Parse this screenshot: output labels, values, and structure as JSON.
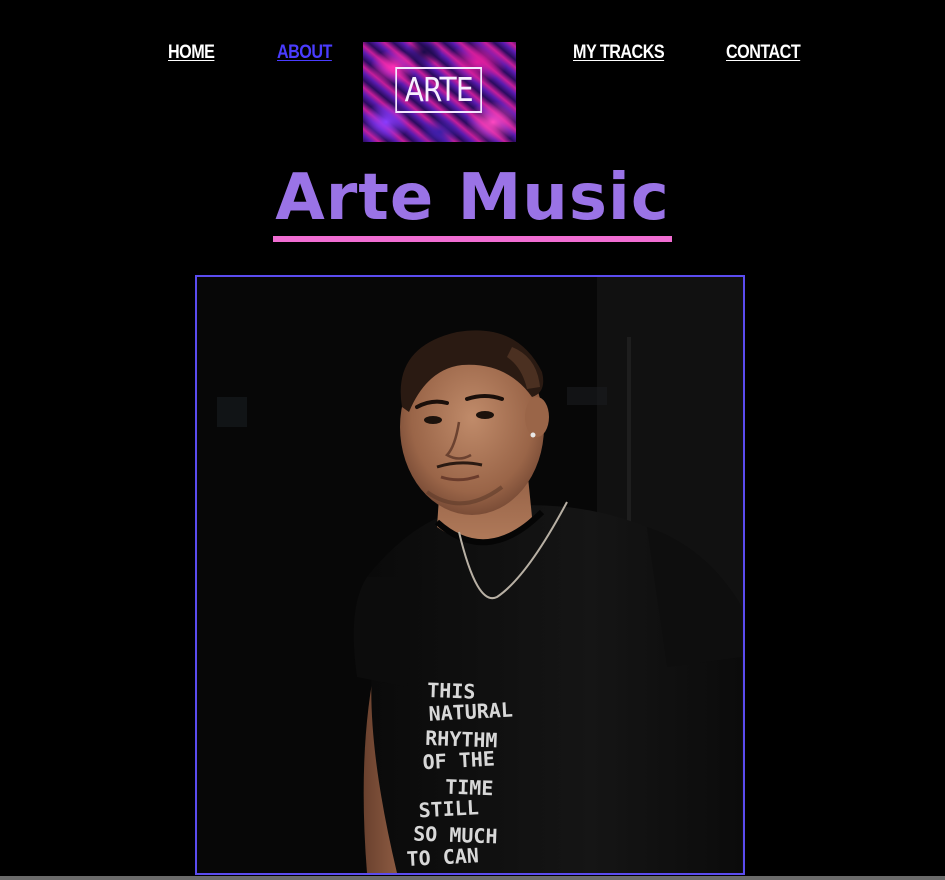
{
  "nav": {
    "home": "HOME",
    "about": "ABOUT",
    "my_tracks": "MY TRACKS",
    "contact": "CONTACT"
  },
  "logo": {
    "text": "ARTE"
  },
  "main": {
    "title": "Arte Music"
  },
  "photo": {
    "shirt_lines": [
      "THIS",
      "NATURAL",
      "RHYTHM",
      "OF THE",
      "TIME",
      "STILL",
      "SO MUCH",
      "TO CAN"
    ]
  },
  "colors": {
    "background": "#000000",
    "active_link": "#4a3cff",
    "title": "#9a73e6",
    "title_underline": "#f06dd2",
    "photo_border": "#5b4cf0"
  }
}
